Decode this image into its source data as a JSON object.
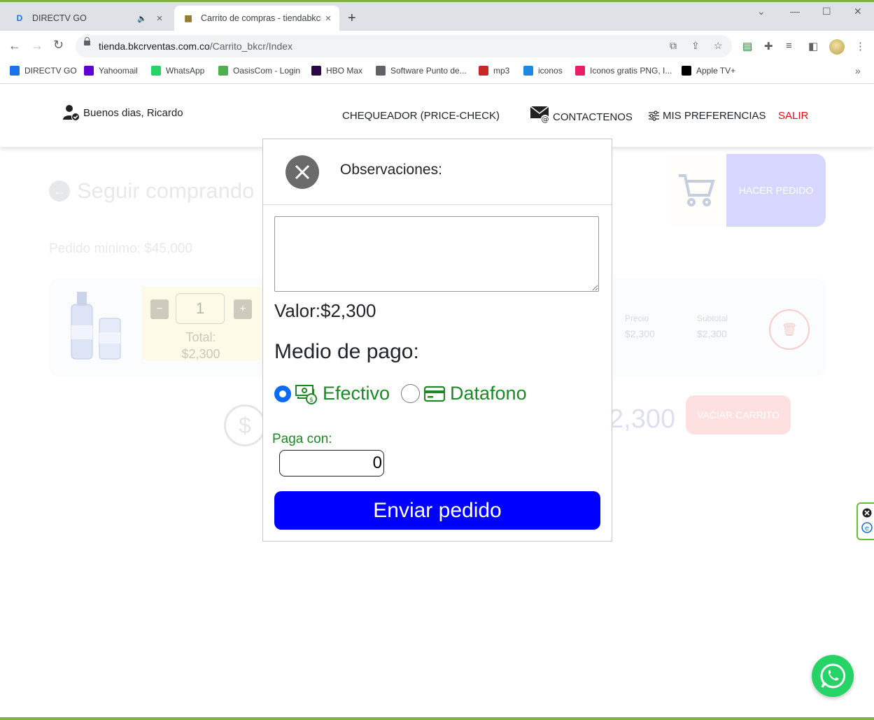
{
  "browser": {
    "tabs": [
      {
        "title": "DIRECTV GO",
        "active": false,
        "muted": true
      },
      {
        "title": "Carrito de compras - tiendabkcr",
        "active": true
      }
    ],
    "url_host": "tienda.bkcrventas.com.co",
    "url_path": "/Carrito_bkcr/Index",
    "bookmarks": [
      {
        "label": "DIRECTV GO",
        "icon": "directv-icon",
        "color": "#1a73e8"
      },
      {
        "label": "Yahoomail",
        "icon": "yahoo-icon",
        "color": "#5f01d1"
      },
      {
        "label": "WhatsApp",
        "icon": "whatsapp-icon",
        "color": "#25d366"
      },
      {
        "label": "OasisCom - Login",
        "icon": "oasiscom-icon",
        "color": "#4caf50"
      },
      {
        "label": "HBO Max",
        "icon": "hbomax-icon",
        "color": "#2a0845"
      },
      {
        "label": "Software Punto de...",
        "icon": "globe-icon",
        "color": "#5f6368"
      },
      {
        "label": "mp3",
        "icon": "mp3-icon",
        "color": "#c62828"
      },
      {
        "label": "iconos",
        "icon": "iconos-icon",
        "color": "#1e88e5"
      },
      {
        "label": "Iconos gratis PNG, I...",
        "icon": "iconos-png-icon",
        "color": "#e91e63"
      },
      {
        "label": "Apple TV+",
        "icon": "appletv-icon",
        "color": "#000000"
      }
    ]
  },
  "header": {
    "greeting": "Buenos dias, Ricardo",
    "nav": {
      "price_check": "CHEQUEADOR (PRICE-CHECK)",
      "contact": "CONTACTENOS",
      "preferences": "MIS PREFERENCIAS",
      "logout": "SALIR"
    }
  },
  "background_page": {
    "back_link": "Seguir comprando",
    "min_order": "Pedido minimo: $45,000",
    "place_order": "HACER PEDIDO",
    "item": {
      "quantity": "1",
      "total_label": "Total:",
      "total_value": "$2,300",
      "price_label": "Precio",
      "price_value": "$2,300",
      "subtotal_label": "Subtotal",
      "subtotal_value": "$2,300"
    },
    "grand_total": "2,300",
    "empty_cart": "VACIAR CARRITO"
  },
  "modal": {
    "title": "Observaciones:",
    "observations_value": "",
    "valor": "Valor:$2,300",
    "payment_heading": "Medio de pago:",
    "payment_options": [
      {
        "label": "Efectivo",
        "icon": "cash-icon",
        "selected": true
      },
      {
        "label": "Datafono",
        "icon": "credit-card-icon",
        "selected": false
      }
    ],
    "pay_with_label": "Paga con:",
    "pay_with_value": "0",
    "submit": "Enviar pedido"
  },
  "colors": {
    "submit_button": "#0000ff",
    "payment_text": "#1a8a24",
    "logout": "#e01010",
    "whatsapp": "#25d366"
  }
}
